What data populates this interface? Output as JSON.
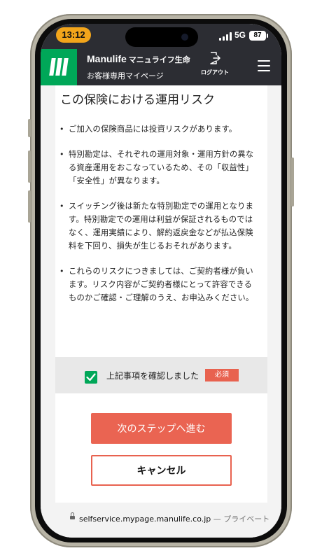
{
  "status_bar": {
    "time": "13:12",
    "network": "5G",
    "battery": "87"
  },
  "header": {
    "brand": "Manulife",
    "brand_jp": "マニュライフ生命",
    "subtitle": "お客様専用マイページ",
    "logout_label": "ログアウト"
  },
  "section": {
    "title": "この保険における運用リスク",
    "bullets": [
      "ご加入の保険商品には投資リスクがあります。",
      "特別勘定は、それぞれの運用対象・運用方針の異なる資産運用をおこなっているため、その「収益性」「安全性」が異なります。",
      "スイッチング後は新たな特別勘定での運用となります。特別勘定での運用は利益が保証されるものではなく、運用実績により、解約返戻金などが払込保険料を下回り、損失が生じるおそれがあります。",
      "これらのリスクにつきましては、ご契約者様が負います。リスク内容がご契約者様にとって許容できるものかご確認・ご理解のうえ、お申込みください。"
    ]
  },
  "confirm": {
    "label": "上記事項を確認しました",
    "required_badge": "必須",
    "checked": true
  },
  "buttons": {
    "next": "次のステップへ進む",
    "cancel": "キャンセル"
  },
  "url_bar": {
    "domain": "selfservice.mypage.manulife.co.jp",
    "suffix": " — プライベート"
  },
  "colors": {
    "brand_green": "#00a758",
    "accent_red": "#ea6452",
    "header_bg": "#2c2d33",
    "time_pill": "#f2a51b"
  }
}
